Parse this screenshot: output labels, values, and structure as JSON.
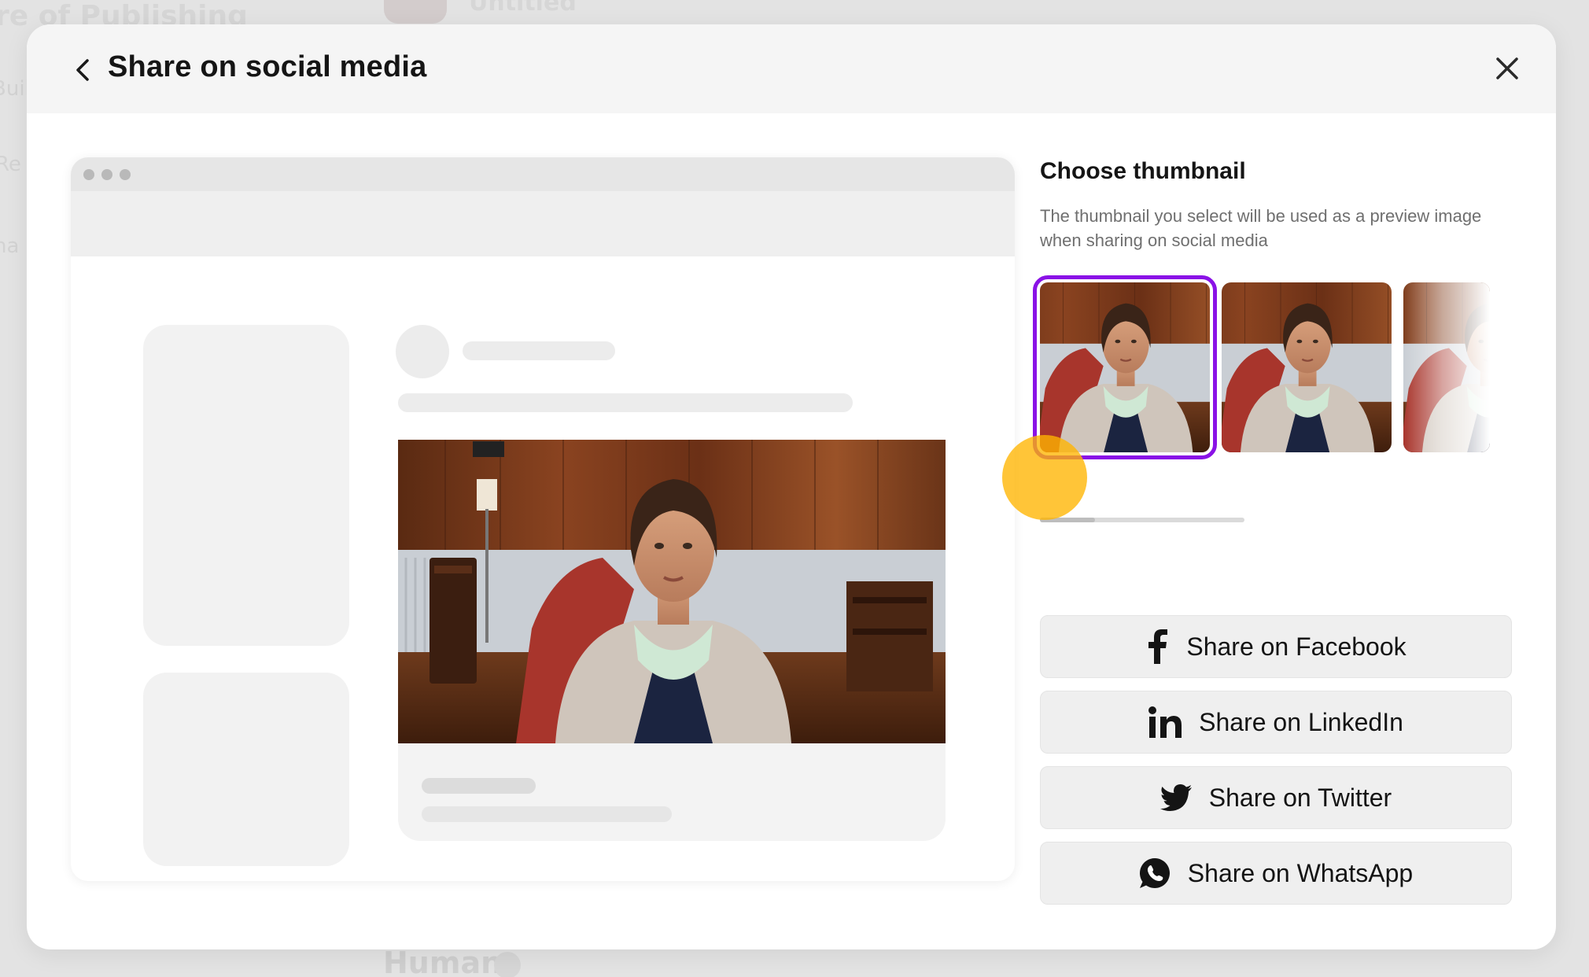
{
  "background": {
    "title_fragment": "re of Publishing",
    "side_fragments": [
      "Buil",
      "Re",
      "na"
    ],
    "top_fragment": "Untitled",
    "bottom_fragment": "Human"
  },
  "modal": {
    "title": "Share on social media",
    "back_icon": "chevron-left-icon",
    "close_icon": "close-icon"
  },
  "thumbnails": {
    "heading": "Choose thumbnail",
    "description": "The thumbnail you select will be used as a preview image when sharing on social media",
    "items_visible": 3,
    "selected_index": 0,
    "accent_color": "#8a12e6"
  },
  "share": {
    "facebook": {
      "label": "Share on Facebook",
      "icon": "facebook-icon"
    },
    "linkedin": {
      "label": "Share on LinkedIn",
      "icon": "linkedin-icon"
    },
    "twitter": {
      "label": "Share on Twitter",
      "icon": "twitter-icon"
    },
    "whatsapp": {
      "label": "Share on WhatsApp",
      "icon": "whatsapp-icon"
    }
  },
  "colors": {
    "cursor_highlight": "#ffb500",
    "button_bg": "#efefef"
  }
}
